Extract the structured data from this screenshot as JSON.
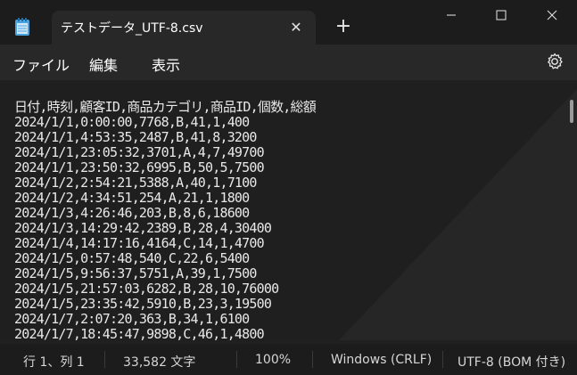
{
  "app": {
    "icon": "notepad-icon"
  },
  "tab": {
    "title": "テストデータ_UTF-8.csv",
    "close_icon": "close-icon"
  },
  "window_controls": {
    "minimize_icon": "minimize-icon",
    "maximize_icon": "maximize-icon",
    "close_icon": "close-icon"
  },
  "new_tab_icon": "plus-icon",
  "menu": {
    "file": "ファイル",
    "edit": "編集",
    "view": "表示",
    "settings_icon": "gear-icon"
  },
  "editor": {
    "lines": [
      "日付,時刻,顧客ID,商品カテゴリ,商品ID,個数,総額",
      "2024/1/1,0:00:00,7768,B,41,1,400",
      "2024/1/1,4:53:35,2487,B,41,8,3200",
      "2024/1/1,23:05:32,3701,A,4,7,49700",
      "2024/1/1,23:50:32,6995,B,50,5,7500",
      "2024/1/2,2:54:21,5388,A,40,1,7100",
      "2024/1/2,4:34:51,254,A,21,1,1800",
      "2024/1/3,4:26:46,203,B,8,6,18600",
      "2024/1/3,14:29:42,2389,B,28,4,30400",
      "2024/1/4,14:17:16,4164,C,14,1,4700",
      "2024/1/5,0:57:48,540,C,22,6,5400",
      "2024/1/5,9:56:37,5751,A,39,1,7500",
      "2024/1/5,21:57:03,6282,B,28,10,76000",
      "2024/1/5,23:35:42,5910,B,23,3,19500",
      "2024/1/7,2:07:20,363,B,34,1,6100",
      "2024/1/7,18:45:47,9898,C,46,1,4800"
    ]
  },
  "status": {
    "position": "行 1、列 1",
    "chars": "33,582 文字",
    "zoom": "100%",
    "line_ending": "Windows (CRLF)",
    "encoding": "UTF-8 (BOM 付き)"
  }
}
